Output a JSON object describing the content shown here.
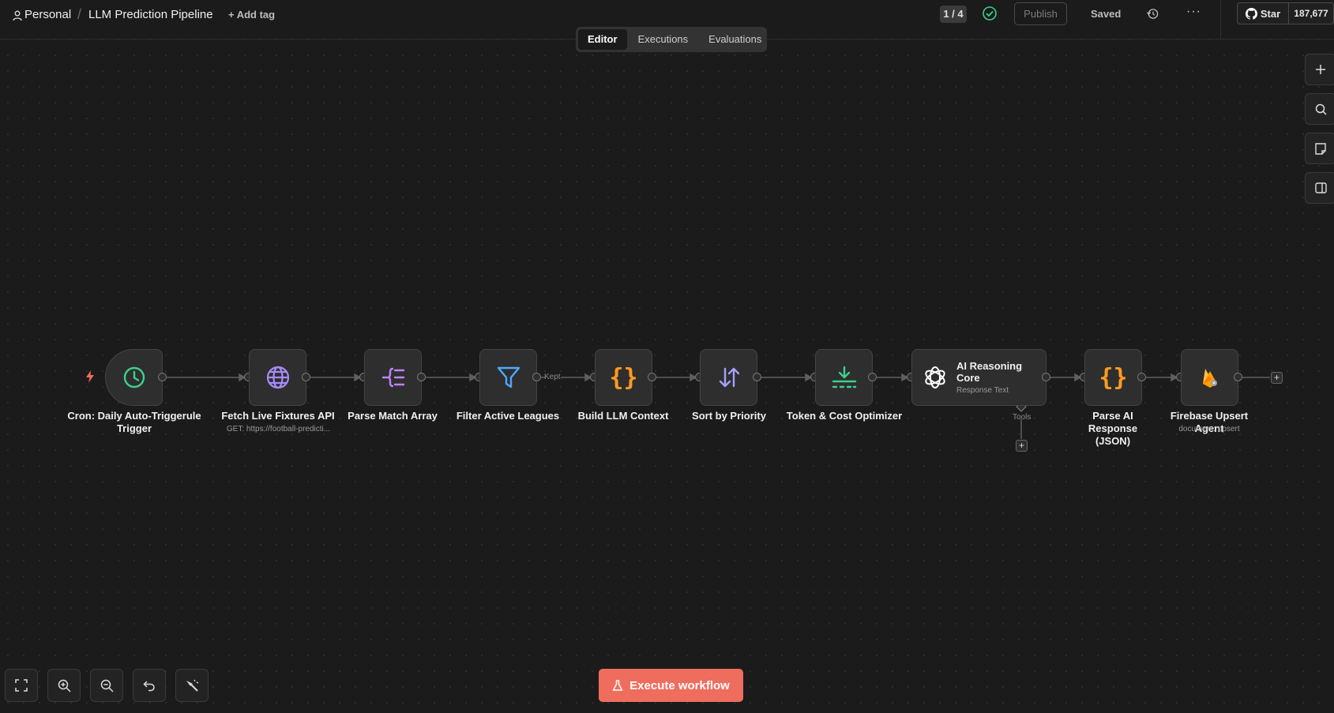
{
  "header": {
    "workspace": "Personal",
    "separator": "/",
    "workflow_name": "LLM Prediction Pipeline",
    "add_tag": "+ Add tag",
    "counter": "1 / 4",
    "publish_label": "Publish",
    "saved_label": "Saved",
    "more_label": "···",
    "github_star": "Star",
    "github_count": "187,677"
  },
  "tabs": [
    {
      "label": "Editor",
      "active": true
    },
    {
      "label": "Executions",
      "active": false
    },
    {
      "label": "Evaluations",
      "active": false
    }
  ],
  "side_buttons": [
    "plus-icon",
    "search-icon",
    "sticky-note-icon",
    "panel-icon"
  ],
  "nodes": [
    {
      "id": "cron",
      "label": "Cron: Daily Auto-Triggerule Trigger",
      "icon": "clock-icon",
      "color": "#3ecf8e"
    },
    {
      "id": "fetch",
      "label": "Fetch Live Fixtures API",
      "subtitle": "GET: https://football-predicti...",
      "icon": "globe-icon",
      "color": "#a78bfa"
    },
    {
      "id": "parse",
      "label": "Parse Match Array",
      "icon": "split-out-icon",
      "color": "#c084fc"
    },
    {
      "id": "filter",
      "label": "Filter Active Leagues",
      "icon": "funnel-icon",
      "color": "#4ea8ff"
    },
    {
      "id": "build",
      "label": "Build LLM Context",
      "icon": "code-braces-icon",
      "color": "#ff9b21"
    },
    {
      "id": "sort",
      "label": "Sort by Priority",
      "icon": "sort-arrows-icon",
      "color": "#a5a0ff"
    },
    {
      "id": "token",
      "label": "Token & Cost Optimizer",
      "icon": "compress-icon",
      "color": "#3ecf8e"
    },
    {
      "id": "ai",
      "label": "AI Reasoning Core",
      "subtitle": "Response Text",
      "icon": "openai-icon",
      "color": "#ffffff"
    },
    {
      "id": "parse_ai",
      "label": "Parse AI Response (JSON)",
      "icon": "code-braces-icon",
      "color": "#ff9b21"
    },
    {
      "id": "firebase",
      "label": "Firebase Upsert Agent",
      "subtitle": "document: upsert",
      "icon": "firebase-icon",
      "color": "#ffa000"
    }
  ],
  "edge_labels": {
    "filter_kept": "Kept",
    "ai_tools": "Tools"
  },
  "footer": {
    "execute_label": "Execute workflow"
  },
  "toolbar": [
    "fit-view-icon",
    "zoom-in-icon",
    "zoom-out-icon",
    "undo-icon",
    "tidy-up-icon"
  ],
  "colors": {
    "accent": "#ef6d5d",
    "background": "#1b1b1b",
    "node": "#2e2e2e",
    "trigger_bolt": "#ef6d5d"
  }
}
